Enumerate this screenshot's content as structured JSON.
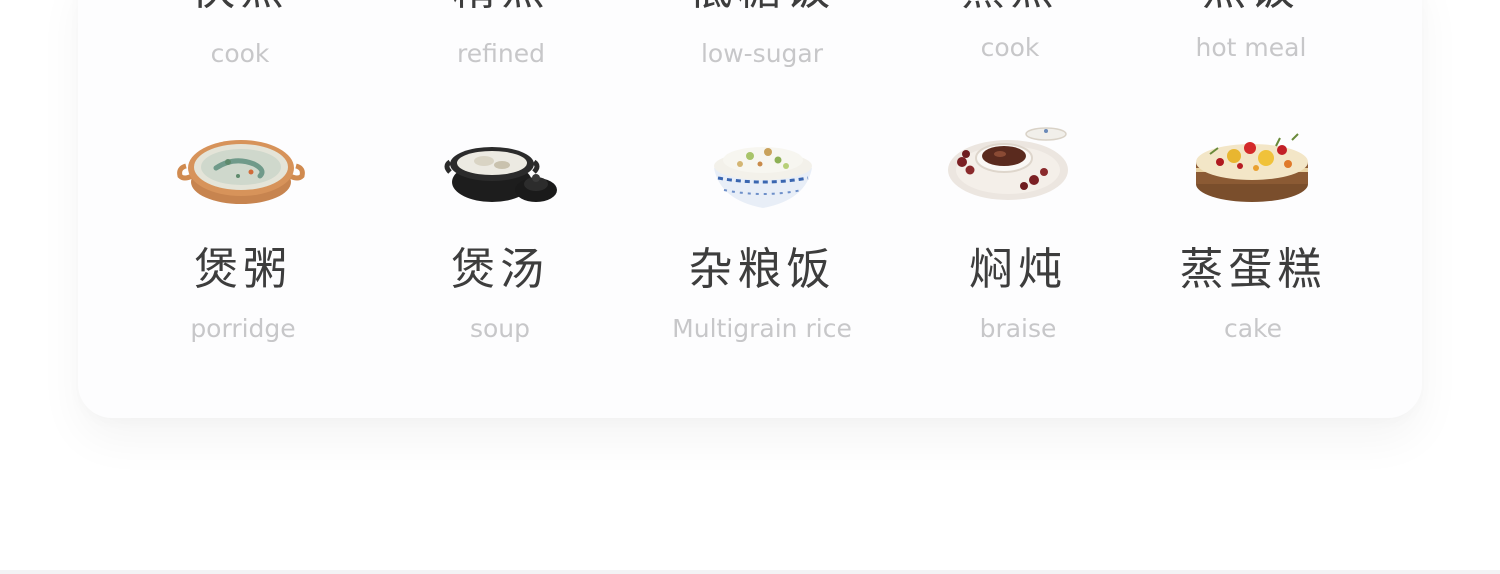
{
  "row_top": [
    {
      "title": "快煮",
      "subtitle": "cook"
    },
    {
      "title": "精煮",
      "subtitle": "refined"
    },
    {
      "title": "低糖饭",
      "subtitle": "low-sugar"
    },
    {
      "title": "蒸煮",
      "subtitle": "cook"
    },
    {
      "title": "热饭",
      "subtitle": "hot meal"
    }
  ],
  "row_bottom": [
    {
      "title": "煲粥",
      "subtitle": "porridge",
      "icon": "porridge-bowl-icon"
    },
    {
      "title": "煲汤",
      "subtitle": "soup",
      "icon": "soup-pot-icon"
    },
    {
      "title": "杂粮饭",
      "subtitle": "Multigrain rice",
      "icon": "rice-bowl-icon"
    },
    {
      "title": "焖炖",
      "subtitle": "braise",
      "icon": "braise-plate-icon"
    },
    {
      "title": "蒸蛋糕",
      "subtitle": "cake",
      "icon": "cake-icon"
    }
  ]
}
